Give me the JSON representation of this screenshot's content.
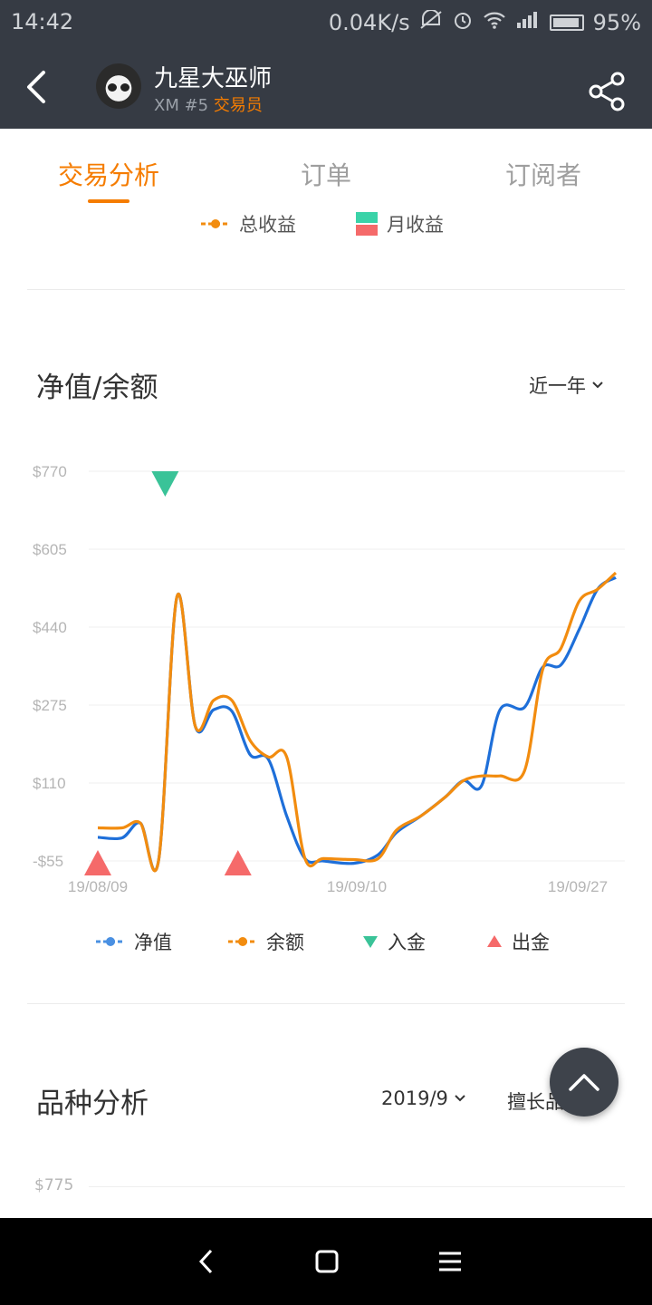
{
  "status_bar": {
    "time": "14:42",
    "speed": "0.04K/s",
    "battery": "95%"
  },
  "header": {
    "name": "九星大巫师",
    "broker": "XM #5",
    "role": "交易员"
  },
  "tabs": [
    {
      "label": "交易分析",
      "active": true
    },
    {
      "label": "订单",
      "active": false
    },
    {
      "label": "订阅者",
      "active": false
    }
  ],
  "top_legend": {
    "total": "总收益",
    "monthly": "月收益"
  },
  "section_networth": {
    "title": "净值/余额",
    "range": "近一年"
  },
  "chart_data": {
    "type": "line",
    "x_labels": [
      "19/08/09",
      "19/09/10",
      "19/09/27"
    ],
    "y_ticks": [
      "$770",
      "$605",
      "$440",
      "$275",
      "$110",
      "-$55"
    ],
    "ylim": [
      -55,
      770
    ],
    "series": [
      {
        "name": "净值",
        "color": "#1e6fd9",
        "points": [
          [
            0,
            -5
          ],
          [
            0.04,
            -6
          ],
          [
            0.07,
            25
          ],
          [
            0.1,
            -52
          ],
          [
            0.13,
            505
          ],
          [
            0.16,
            230
          ],
          [
            0.19,
            265
          ],
          [
            0.22,
            262
          ],
          [
            0.25,
            170
          ],
          [
            0.28,
            160
          ],
          [
            0.31,
            40
          ],
          [
            0.34,
            -50
          ],
          [
            0.37,
            -55
          ],
          [
            0.42,
            -60
          ],
          [
            0.46,
            -42
          ],
          [
            0.49,
            5
          ],
          [
            0.53,
            40
          ],
          [
            0.57,
            80
          ],
          [
            0.6,
            115
          ],
          [
            0.63,
            105
          ],
          [
            0.66,
            265
          ],
          [
            0.7,
            270
          ],
          [
            0.73,
            355
          ],
          [
            0.76,
            360
          ],
          [
            0.79,
            435
          ],
          [
            0.82,
            520
          ],
          [
            0.85,
            545
          ]
        ]
      },
      {
        "name": "余额",
        "color": "#f28c0f",
        "points": [
          [
            0,
            15
          ],
          [
            0.04,
            15
          ],
          [
            0.07,
            25
          ],
          [
            0.1,
            -52
          ],
          [
            0.13,
            505
          ],
          [
            0.16,
            230
          ],
          [
            0.19,
            285
          ],
          [
            0.22,
            285
          ],
          [
            0.25,
            200
          ],
          [
            0.28,
            165
          ],
          [
            0.31,
            165
          ],
          [
            0.34,
            -50
          ],
          [
            0.37,
            -50
          ],
          [
            0.42,
            -52
          ],
          [
            0.46,
            -50
          ],
          [
            0.49,
            10
          ],
          [
            0.53,
            40
          ],
          [
            0.57,
            80
          ],
          [
            0.6,
            115
          ],
          [
            0.63,
            125
          ],
          [
            0.66,
            125
          ],
          [
            0.7,
            135
          ],
          [
            0.73,
            350
          ],
          [
            0.76,
            395
          ],
          [
            0.79,
            495
          ],
          [
            0.82,
            520
          ],
          [
            0.85,
            555
          ]
        ]
      }
    ],
    "deposits": [
      0.115
    ],
    "withdrawals": [
      0.0,
      0.23
    ],
    "legend": {
      "net": "净值",
      "balance": "余额",
      "deposit": "入金",
      "withdraw": "出金"
    }
  },
  "section_variety": {
    "title": "品种分析",
    "period": "2019/9",
    "filter": "擅长品种",
    "y_top": "$775"
  }
}
